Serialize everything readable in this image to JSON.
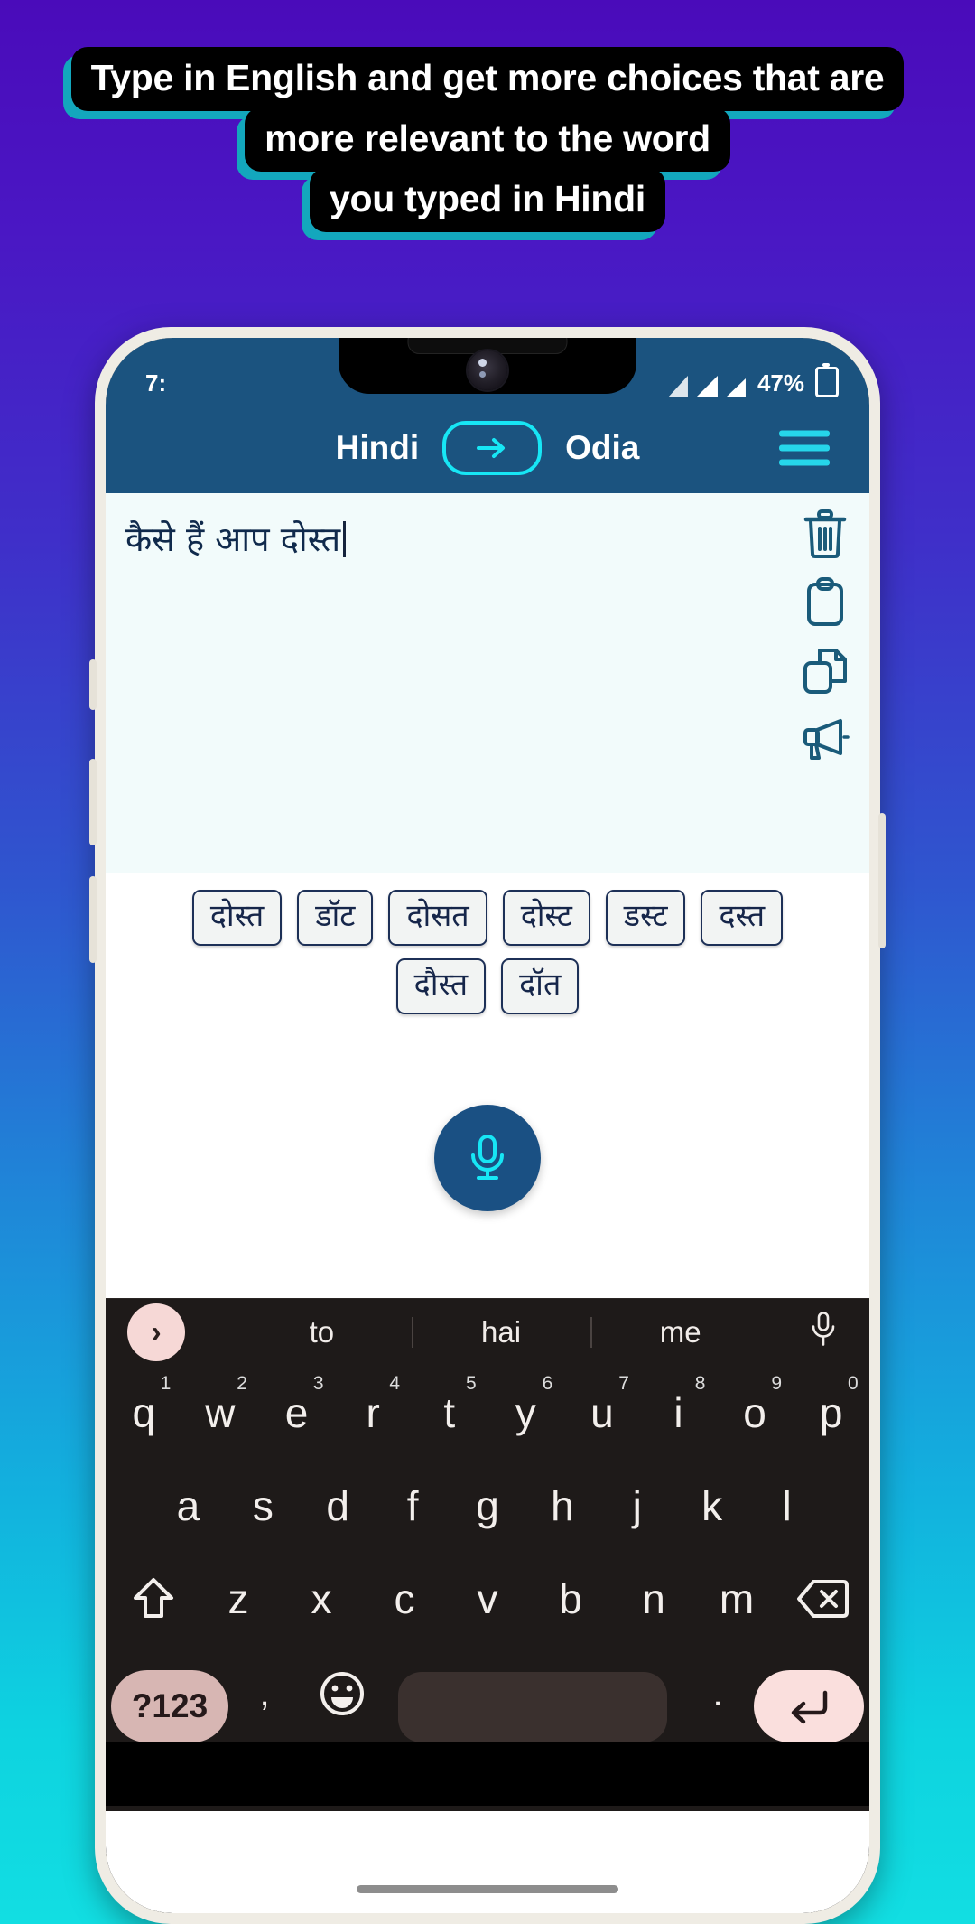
{
  "promo": {
    "line1": "Type in English and get more choices that are",
    "line2": "more relevant to the word",
    "line3": "you typed in Hindi",
    "shadow_color": "#13a7bd",
    "bg_color": "#000000"
  },
  "background": {
    "top_color": "#4a0bba",
    "bottom_color": "#12dee2"
  },
  "phone": {
    "statusbar": {
      "time": "7:",
      "battery_percent": "47%",
      "icons": [
        "alarm-icon",
        "signal-icon",
        "signal-icon",
        "battery-icon"
      ]
    },
    "header": {
      "source_language": "Hindi",
      "target_language": "Odia",
      "swap_icon": "arrow-right-icon",
      "menu_icon": "hamburger-menu-icon",
      "bg_color": "#1b537f",
      "accent_color": "#17e6f5"
    },
    "editor": {
      "typed_text": "कैसे हैं आप दोस्त",
      "bg_color": "#f2fbfb",
      "text_color": "#102a4c",
      "tools": [
        {
          "name": "delete-icon",
          "label": "Delete"
        },
        {
          "name": "paste-icon",
          "label": "Paste"
        },
        {
          "name": "copy-icon",
          "label": "Copy"
        },
        {
          "name": "speak-icon",
          "label": "Speak"
        }
      ]
    },
    "suggestions": {
      "row1": [
        "दोस्त",
        "डॉट",
        "दोसत",
        "दोस्ट",
        "डस्ट",
        "दस्त"
      ],
      "row2": [
        "दौस्त",
        "दॉत"
      ]
    },
    "mic_button": {
      "icon": "microphone-icon",
      "bg_color": "#1a5083",
      "icon_color": "#17e6f5"
    },
    "keyboard": {
      "suggestion_bar": {
        "expand_icon": "chevron-right-icon",
        "words": [
          "to",
          "hai",
          "me"
        ],
        "mic_icon": "microphone-icon"
      },
      "row1": [
        {
          "letter": "q",
          "num": "1"
        },
        {
          "letter": "w",
          "num": "2"
        },
        {
          "letter": "e",
          "num": "3"
        },
        {
          "letter": "r",
          "num": "4"
        },
        {
          "letter": "t",
          "num": "5"
        },
        {
          "letter": "y",
          "num": "6"
        },
        {
          "letter": "u",
          "num": "7"
        },
        {
          "letter": "i",
          "num": "8"
        },
        {
          "letter": "o",
          "num": "9"
        },
        {
          "letter": "p",
          "num": "0"
        }
      ],
      "row2": [
        "a",
        "s",
        "d",
        "f",
        "g",
        "h",
        "j",
        "k",
        "l"
      ],
      "row3": [
        "z",
        "x",
        "c",
        "v",
        "b",
        "n",
        "m"
      ],
      "row3_shift_icon": "shift-icon",
      "row3_backspace_icon": "backspace-icon",
      "row4": {
        "symbols_key": "?123",
        "comma": ",",
        "emoji_icon": "emoji-icon",
        "space": "",
        "period": ".",
        "enter_icon": "enter-icon"
      }
    }
  }
}
